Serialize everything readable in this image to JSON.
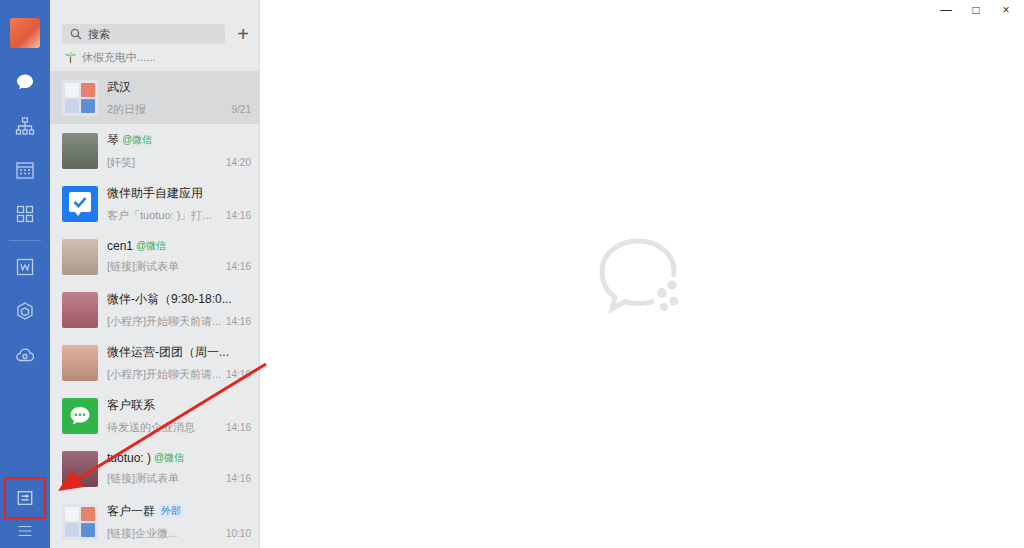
{
  "window": {
    "controls": [
      "—",
      "□",
      "×"
    ]
  },
  "nav": {
    "top": [
      {
        "kind": "chat",
        "selected": true
      },
      {
        "kind": "contacts",
        "selected": false
      },
      {
        "kind": "calendar",
        "selected": false
      },
      {
        "kind": "workbench",
        "selected": false
      }
    ],
    "middle": [
      {
        "kind": "docs",
        "selected": false
      },
      {
        "kind": "cube",
        "selected": false
      },
      {
        "kind": "drive",
        "selected": false
      }
    ],
    "bottom": [
      {
        "kind": "tasks",
        "selected": false,
        "annotated": true
      },
      {
        "kind": "menu",
        "selected": false,
        "annotated": false
      }
    ]
  },
  "search": {
    "placeholder": "搜索",
    "add": "+"
  },
  "status": {
    "text": "休假充电中......"
  },
  "conversations": [
    {
      "name": "武汉",
      "tag": null,
      "preview": "2的日报",
      "time": "9/21",
      "selected": true,
      "avatar": {
        "kind": "group",
        "color": "#dfe3ea"
      }
    },
    {
      "name": "琴",
      "tag": {
        "text": "@微信",
        "kind": "wechat"
      },
      "preview": "[奸笑]",
      "time": "14:20",
      "selected": false,
      "avatar": {
        "kind": "photo",
        "color": "#6f7a6c"
      }
    },
    {
      "name": "微伴助手自建应用",
      "tag": null,
      "preview": "客户「tuotuo: )」打...",
      "time": "14:16",
      "selected": false,
      "avatar": {
        "kind": "app-check",
        "color": "#1f7cf0"
      }
    },
    {
      "name": "cen1",
      "tag": {
        "text": "@微信",
        "kind": "wechat"
      },
      "preview": "[链接]测试表单",
      "time": "14:16",
      "selected": false,
      "avatar": {
        "kind": "photo",
        "color": "#c9b3a2"
      }
    },
    {
      "name": "微伴-小翁（9:30-18:0...",
      "tag": null,
      "preview": "[小程序]开始聊天前请...",
      "time": "14:16",
      "selected": false,
      "avatar": {
        "kind": "photo",
        "color": "#b66a78"
      }
    },
    {
      "name": "微伴运营-团团（周一...",
      "tag": null,
      "preview": "[小程序]开始聊天前请...",
      "time": "14:16",
      "selected": false,
      "avatar": {
        "kind": "photo",
        "color": "#d9a48d"
      }
    },
    {
      "name": "客户联系",
      "tag": null,
      "preview": "待发送的企业消息",
      "time": "14:16",
      "selected": false,
      "avatar": {
        "kind": "wechat",
        "color": "#2fb54a"
      }
    },
    {
      "name": "tuotuo: )",
      "tag": {
        "text": "@微信",
        "kind": "wechat"
      },
      "preview": "[链接]测试表单",
      "time": "14:16",
      "selected": false,
      "avatar": {
        "kind": "photo",
        "color": "#8a5060"
      }
    },
    {
      "name": "客户一群",
      "tag": {
        "text": "外部",
        "kind": "external"
      },
      "preview": "[链接]企业微...",
      "time": "10:10",
      "selected": false,
      "avatar": {
        "kind": "group",
        "color": "#dfe3ea"
      }
    }
  ]
}
